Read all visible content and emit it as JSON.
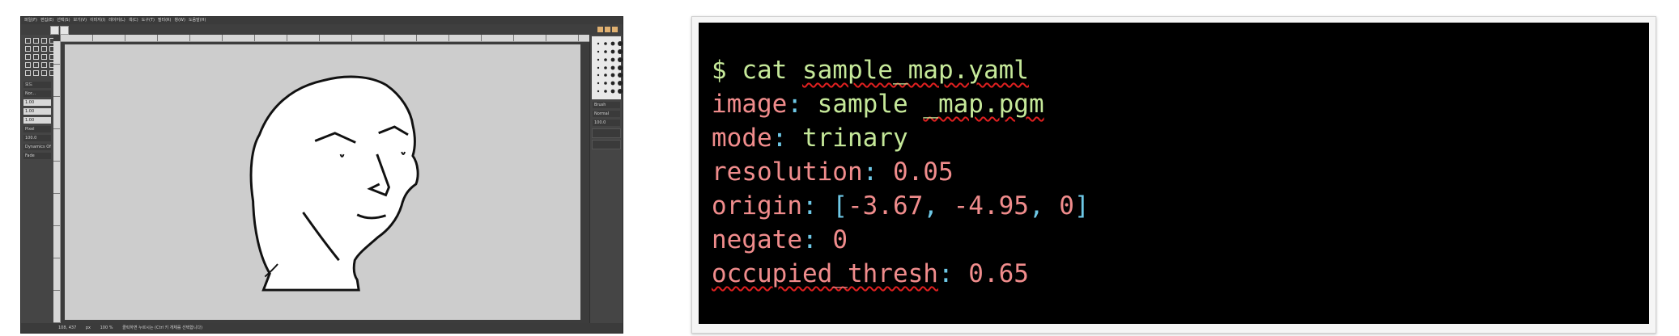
{
  "gimp": {
    "menu_items": [
      "파일(F)",
      "편집(E)",
      "선택(S)",
      "보기(V)",
      "이미지(I)",
      "레이어(L)",
      "색(C)",
      "도구(T)",
      "필터(R)",
      "창(W)",
      "도움말(H)"
    ],
    "tool_options": [
      "모드",
      "Nor...",
      "1.00",
      "1.00",
      "1.00",
      "Pixel",
      "100.0",
      "Dynamics Off",
      "Fade"
    ],
    "dock_labels": [
      "Brush",
      "Normal",
      "100.0"
    ],
    "status": {
      "coords": "108, 437",
      "unit": "px",
      "zoom": "100 %",
      "message": "클릭하면 누르시는 (Ctrl 키 개체를 선택합니다)"
    }
  },
  "terminal": {
    "lines": [
      [
        {
          "t": "$ cat ",
          "c": "green"
        },
        {
          "t": "sample_map.yaml",
          "c": "green",
          "sq": true
        }
      ],
      [
        {
          "t": "image",
          "c": "salmon"
        },
        {
          "t": ": ",
          "c": "cyan"
        },
        {
          "t": "sample ",
          "c": "green"
        },
        {
          "t": "_map.pgm",
          "c": "green",
          "sq": true
        }
      ],
      [
        {
          "t": "mode",
          "c": "salmon"
        },
        {
          "t": ": ",
          "c": "cyan"
        },
        {
          "t": "trinary",
          "c": "green"
        }
      ],
      [
        {
          "t": "resolution",
          "c": "salmon"
        },
        {
          "t": ": ",
          "c": "cyan"
        },
        {
          "t": "0.05",
          "c": "salmon"
        }
      ],
      [
        {
          "t": "origin",
          "c": "salmon"
        },
        {
          "t": ": ",
          "c": "cyan"
        },
        {
          "t": "[",
          "c": "cyan"
        },
        {
          "t": "-3.67",
          "c": "salmon"
        },
        {
          "t": ", ",
          "c": "cyan"
        },
        {
          "t": "-4.95",
          "c": "salmon"
        },
        {
          "t": ", ",
          "c": "cyan"
        },
        {
          "t": "0",
          "c": "salmon"
        },
        {
          "t": "]",
          "c": "cyan"
        }
      ],
      [
        {
          "t": "negate",
          "c": "salmon"
        },
        {
          "t": ": ",
          "c": "cyan"
        },
        {
          "t": "0",
          "c": "salmon"
        }
      ],
      [
        {
          "t": "occupied_thresh",
          "c": "salmon",
          "sq": true
        },
        {
          "t": ": ",
          "c": "cyan"
        },
        {
          "t": "0.65",
          "c": "salmon"
        }
      ]
    ]
  },
  "colors": {
    "terminal_bg": "#000000",
    "key": "#f08c8c",
    "string": "#c5e899",
    "punct": "#6ec8e6",
    "spellcheck": "#e02020"
  }
}
